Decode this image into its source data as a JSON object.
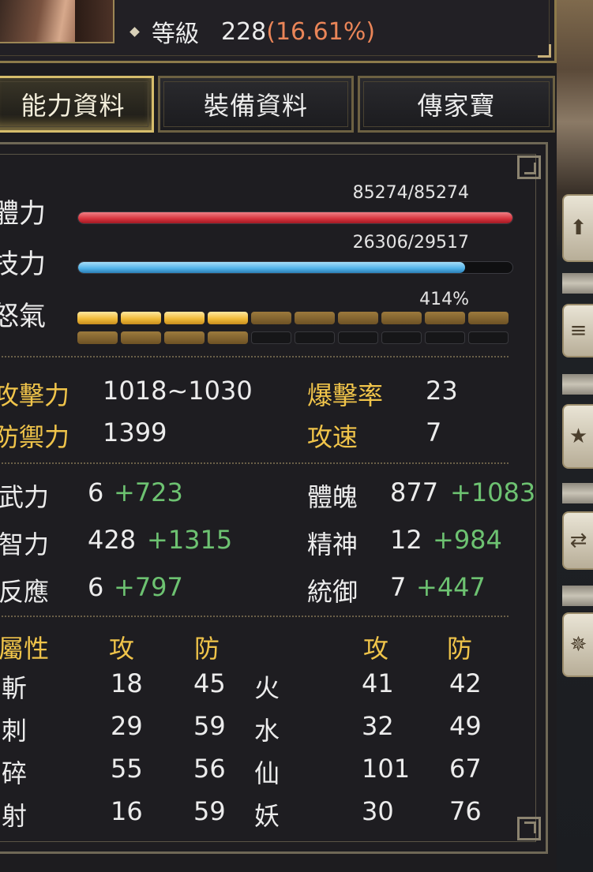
{
  "header": {
    "level_label": "等級",
    "level_value": "228",
    "level_percent": "(16.61%)"
  },
  "tabs": [
    {
      "label": "能力資料",
      "active": true
    },
    {
      "label": "裝備資料",
      "active": false
    },
    {
      "label": "傳家寶",
      "active": false
    }
  ],
  "bars": {
    "hp": {
      "label": "體力",
      "text": "85274/85274",
      "current": 85274,
      "max": 85274
    },
    "mp": {
      "label": "技力",
      "text": "26306/29517",
      "current": 26306,
      "max": 29517
    },
    "rage": {
      "label": "怒氣",
      "text": "414%",
      "full_segments": 4,
      "dim_segments": 10,
      "total_segments": 20
    }
  },
  "combat": {
    "attack_label": "攻擊力",
    "attack_value": "1018~1030",
    "crit_label": "爆擊率",
    "crit_value": "23",
    "defense_label": "防禦力",
    "defense_value": "1399",
    "speed_label": "攻速",
    "speed_value": "7"
  },
  "attributes": {
    "str_label": "武力",
    "str_base": "6",
    "str_bonus": "+723",
    "con_label": "體魄",
    "con_base": "877",
    "con_bonus": "+1083",
    "int_label": "智力",
    "int_base": "428",
    "int_bonus": "+1315",
    "spi_label": "精神",
    "spi_base": "12",
    "spi_bonus": "+984",
    "agi_label": "反應",
    "agi_base": "6",
    "agi_bonus": "+797",
    "cmd_label": "統御",
    "cmd_base": "7",
    "cmd_bonus": "+447"
  },
  "elements": {
    "header_label": "屬性",
    "atk_header": "攻",
    "def_header": "防",
    "atk_header2": "攻",
    "def_header2": "防",
    "rows": [
      {
        "left": "斬",
        "la": "18",
        "ld": "45",
        "right": "火",
        "ra": "41",
        "rd": "42"
      },
      {
        "left": "刺",
        "la": "29",
        "ld": "59",
        "right": "水",
        "ra": "32",
        "rd": "49"
      },
      {
        "left": "碎",
        "la": "55",
        "ld": "56",
        "right": "仙",
        "ra": "101",
        "rd": "67"
      },
      {
        "left": "射",
        "la": "16",
        "ld": "59",
        "right": "妖",
        "ra": "30",
        "rd": "76"
      }
    ]
  },
  "colors": {
    "gold_label": "#f0c44a",
    "bonus_green": "#6dc271",
    "level_percent": "#ea8558",
    "hp_bar": "#d6323c",
    "mp_bar": "#4fb1e7",
    "rage_bar": "#f2bd3b"
  }
}
